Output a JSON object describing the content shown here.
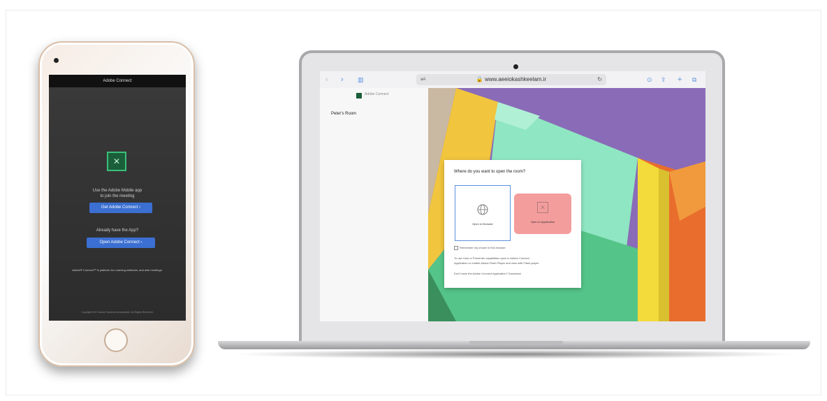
{
  "phone": {
    "header": "Adobe Connect",
    "use_text_1": "Use the Adobe Mobile app",
    "use_text_2": "to join the meeting",
    "get_button": "Get Adobe Connect",
    "already_text": "Already have the App?",
    "open_button": "Open Adobe Connect",
    "platform_text": "Adobe® Connect™ is platform for Learning webinars, and web meetings.",
    "copyright": "Copyright 2017 Adobe Systems Incorporated. All Rights Reserved."
  },
  "browser": {
    "url": "www.aeeiokashkeelam.ir",
    "aa": "aA",
    "sidebar_brand": "Adobe Connect",
    "room_name": "Peter's Room"
  },
  "dialog": {
    "title": "Where do you want to open the room?",
    "option_browser": "Open in Browser",
    "option_app": "Open in Application",
    "remember": "Remember my choice in this browser",
    "info_1": "To use Host or Presenter capabilities open in Adobe Connect",
    "info_2": "Application or enable Adobe Flash Player and view with Flash player.",
    "dont_have": "Don't have the Adobe Connect Application? Download"
  },
  "colors": {
    "accent": "#3b6fd1",
    "app_option": "#f49d9d",
    "browser_option_border": "#5b8fe0",
    "adobe_green": "#1b5e3a"
  }
}
